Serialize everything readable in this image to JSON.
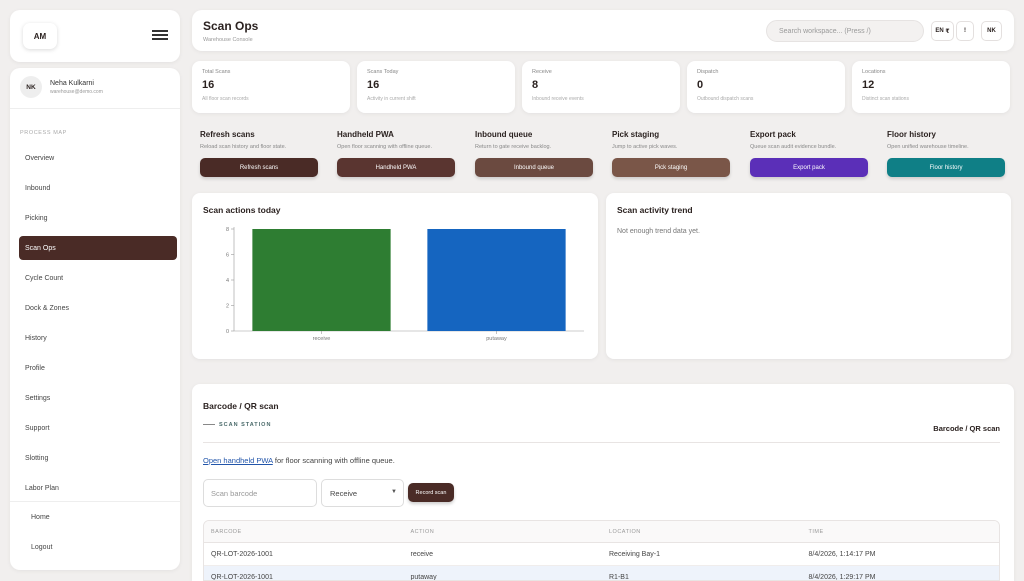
{
  "brand": {
    "initials": "AM"
  },
  "user": {
    "name": "Neha Kulkarni",
    "email": "warehouse@demo.com",
    "initials": "NK"
  },
  "sidebar": {
    "section_label": "PROCESS MAP",
    "items": [
      {
        "label": "Overview"
      },
      {
        "label": "Inbound"
      },
      {
        "label": "Picking"
      },
      {
        "label": "Scan Ops",
        "active": true
      },
      {
        "label": "Cycle Count"
      },
      {
        "label": "Dock & Zones"
      },
      {
        "label": "History"
      },
      {
        "label": "Profile"
      },
      {
        "label": "Settings"
      },
      {
        "label": "Support"
      },
      {
        "label": "Slotting"
      },
      {
        "label": "Labor Plan"
      }
    ],
    "bottom": [
      {
        "label": "Home"
      },
      {
        "label": "Logout"
      }
    ]
  },
  "header": {
    "title": "Scan Ops",
    "subtitle": "Warehouse Console",
    "search_placeholder": "Search workspace... (Press /)",
    "lang": "EN",
    "currency": "₹",
    "info": "!",
    "user_initials": "NK"
  },
  "stats": [
    {
      "label": "Total Scans",
      "value": "16",
      "sub": "All floor scan records"
    },
    {
      "label": "Scans Today",
      "value": "16",
      "sub": "Activity in current shift"
    },
    {
      "label": "Receive",
      "value": "8",
      "sub": "Inbound receive events"
    },
    {
      "label": "Dispatch",
      "value": "0",
      "sub": "Outbound dispatch scans"
    },
    {
      "label": "Locations",
      "value": "12",
      "sub": "Distinct scan stations"
    }
  ],
  "actions": [
    {
      "title": "Refresh scans",
      "desc": "Reload scan history and floor state.",
      "button": "Refresh scans",
      "color": "#4a2b26"
    },
    {
      "title": "Handheld PWA",
      "desc": "Open floor scanning with offline queue.",
      "button": "Handheld PWA",
      "color": "#5a3530"
    },
    {
      "title": "Inbound queue",
      "desc": "Return to gate receive backlog.",
      "button": "Inbound queue",
      "color": "#6b4a40"
    },
    {
      "title": "Pick staging",
      "desc": "Jump to active pick waves.",
      "button": "Pick staging",
      "color": "#7a5648"
    },
    {
      "title": "Export pack",
      "desc": "Queue scan audit evidence bundle.",
      "button": "Export pack",
      "color": "#5b2fb8"
    },
    {
      "title": "Floor history",
      "desc": "Open unified warehouse timeline.",
      "button": "Floor history",
      "color": "#0f7f86"
    }
  ],
  "chart_title": "Scan actions today",
  "chart_data": {
    "type": "bar",
    "categories": [
      "receive",
      "putaway"
    ],
    "values": [
      8,
      8
    ],
    "colors": [
      "#2e7d32",
      "#1565c0"
    ],
    "yticks": [
      "0",
      "2",
      "4",
      "6",
      "8"
    ],
    "ylim": [
      0,
      8
    ],
    "title": "",
    "xlabel": "",
    "ylabel": ""
  },
  "trend": {
    "title": "Scan activity trend",
    "empty": "Not enough trend data yet."
  },
  "scan": {
    "title": "Barcode / QR scan",
    "station_label": "SCAN STATION",
    "right_title": "Barcode / QR scan",
    "link_text": "Open handheld PWA",
    "link_suffix": " for floor scanning with offline queue.",
    "input_placeholder": "Scan barcode",
    "select_value": "Receive",
    "record_button": "Record scan"
  },
  "table": {
    "headers": [
      "BARCODE",
      "ACTION",
      "LOCATION",
      "TIME"
    ],
    "rows": [
      [
        "QR-LOT-2026-1001",
        "receive",
        "Receiving Bay-1",
        "8/4/2026, 1:14:17 PM"
      ],
      [
        "QR-LOT-2026-1001",
        "putaway",
        "R1-B1",
        "8/4/2026, 1:29:17 PM"
      ]
    ]
  }
}
